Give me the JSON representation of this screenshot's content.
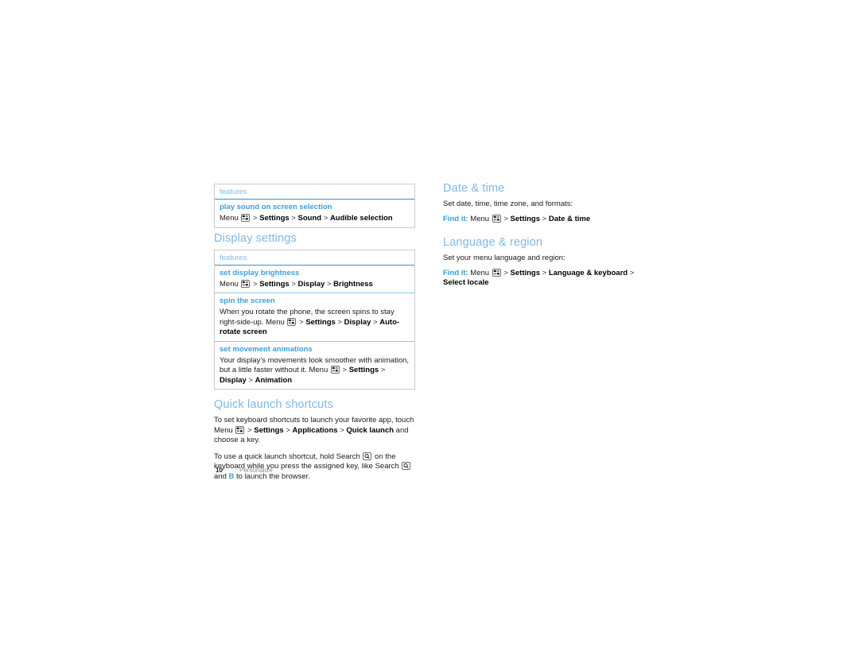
{
  "page": {
    "number": "10",
    "chapter": "Personalize",
    "accent_heading_color": "#7fb9e8",
    "accent_link_color": "#3d9fdd",
    "table_border_color": "#c9c9c9",
    "table_rule_color": "#2196e0"
  },
  "icons": {
    "menu_key": "menu-grid-key-icon",
    "search_key": "search-magnifier-key-icon"
  },
  "left_column": {
    "sound_table": {
      "header": "features",
      "rows": [
        {
          "title": "play sound on screen selection",
          "body_parts": [
            {
              "t": "text",
              "v": "Menu "
            },
            {
              "t": "key",
              "v": "menu-grid-key-icon"
            },
            {
              "t": "gt",
              "v": " > "
            },
            {
              "t": "bold",
              "v": "Settings"
            },
            {
              "t": "gt",
              "v": " > "
            },
            {
              "t": "bold",
              "v": "Sound"
            },
            {
              "t": "gt",
              "v": " > "
            },
            {
              "t": "bold",
              "v": "Audible selection"
            }
          ]
        }
      ]
    },
    "display_heading": "Display settings",
    "display_table": {
      "header": "features",
      "rows": [
        {
          "title": "set display brightness",
          "body_parts": [
            {
              "t": "text",
              "v": "Menu "
            },
            {
              "t": "key",
              "v": "menu-grid-key-icon"
            },
            {
              "t": "gt",
              "v": " > "
            },
            {
              "t": "bold",
              "v": "Settings"
            },
            {
              "t": "gt",
              "v": " > "
            },
            {
              "t": "bold",
              "v": "Display"
            },
            {
              "t": "gt",
              "v": " > "
            },
            {
              "t": "bold",
              "v": "Brightness"
            }
          ]
        },
        {
          "title": "spin the screen",
          "body_parts": [
            {
              "t": "text",
              "v": "When you rotate the phone, the screen spins to stay right-side-up. Menu "
            },
            {
              "t": "key",
              "v": "menu-grid-key-icon"
            },
            {
              "t": "gt",
              "v": " > "
            },
            {
              "t": "bold",
              "v": "Settings"
            },
            {
              "t": "gt",
              "v": " > "
            },
            {
              "t": "bold",
              "v": "Display"
            },
            {
              "t": "gt",
              "v": " > "
            },
            {
              "t": "bold",
              "v": "Auto-rotate screen"
            }
          ]
        },
        {
          "title": "set movement animations",
          "body_parts": [
            {
              "t": "text",
              "v": "Your display's movements look smoother with animation, but a little faster without it. Menu "
            },
            {
              "t": "key",
              "v": "menu-grid-key-icon"
            },
            {
              "t": "gt",
              "v": " > "
            },
            {
              "t": "bold",
              "v": "Settings"
            },
            {
              "t": "gt",
              "v": " > "
            },
            {
              "t": "bold",
              "v": "Display"
            },
            {
              "t": "gt",
              "v": " > "
            },
            {
              "t": "bold",
              "v": "Animation"
            }
          ]
        }
      ]
    },
    "quick_launch_heading": "Quick launch shortcuts",
    "quick_launch_paragraphs": [
      [
        {
          "t": "text",
          "v": "To set keyboard shortcuts to launch your favorite app, touch Menu "
        },
        {
          "t": "key",
          "v": "menu-grid-key-icon"
        },
        {
          "t": "gt",
          "v": " > "
        },
        {
          "t": "bold",
          "v": "Settings"
        },
        {
          "t": "gt",
          "v": " > "
        },
        {
          "t": "bold",
          "v": "Applications"
        },
        {
          "t": "gt",
          "v": " > "
        },
        {
          "t": "bold",
          "v": "Quick launch"
        },
        {
          "t": "text",
          "v": " and choose a key."
        }
      ],
      [
        {
          "t": "text",
          "v": "To use a quick launch shortcut, hold Search "
        },
        {
          "t": "searchkey",
          "v": "search-magnifier-key-icon"
        },
        {
          "t": "text",
          "v": " on the keyboard while you press the assigned key, like Search "
        },
        {
          "t": "searchkey",
          "v": "search-magnifier-key-icon"
        },
        {
          "t": "text",
          "v": " and "
        },
        {
          "t": "keychar",
          "v": "B"
        },
        {
          "t": "text",
          "v": " to launch the browser."
        }
      ]
    ]
  },
  "right_column": {
    "sections": [
      {
        "heading": "Date & time",
        "intro": "Set date, time, time zone, and formats:",
        "findit_label": "Find it:",
        "findit_parts": [
          {
            "t": "text",
            "v": " Menu "
          },
          {
            "t": "key",
            "v": "menu-grid-key-icon"
          },
          {
            "t": "gt",
            "v": " > "
          },
          {
            "t": "bold",
            "v": "Settings"
          },
          {
            "t": "gt",
            "v": " > "
          },
          {
            "t": "bold",
            "v": "Date & time"
          }
        ]
      },
      {
        "heading": "Language & region",
        "intro": "Set your menu language and region:",
        "findit_label": "Find it:",
        "findit_parts": [
          {
            "t": "text",
            "v": " Menu "
          },
          {
            "t": "key",
            "v": "menu-grid-key-icon"
          },
          {
            "t": "gt",
            "v": " > "
          },
          {
            "t": "bold",
            "v": "Settings"
          },
          {
            "t": "gt",
            "v": " > "
          },
          {
            "t": "bold",
            "v": "Language & keyboard"
          },
          {
            "t": "gt",
            "v": " > "
          },
          {
            "t": "bold",
            "v": "Select locale"
          }
        ]
      }
    ]
  }
}
